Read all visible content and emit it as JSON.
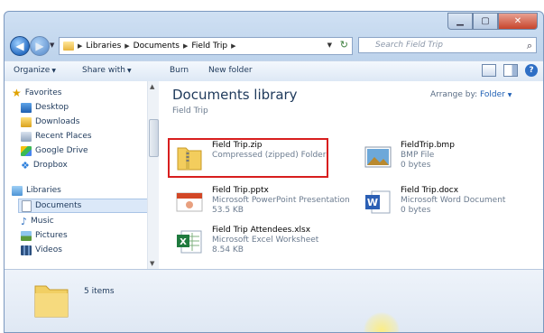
{
  "colors": {
    "accent": "#1e395b",
    "highlight_border": "#d81e1e"
  },
  "address": {
    "crumbs": [
      "Libraries",
      "Documents",
      "Field Trip"
    ],
    "search_placeholder": "Search Field Trip"
  },
  "toolbar": {
    "organize": "Organize",
    "share_with": "Share with",
    "burn": "Burn",
    "new_folder": "New folder"
  },
  "nav": {
    "favorites_header": "Favorites",
    "favorites": [
      "Desktop",
      "Downloads",
      "Recent Places",
      "Google Drive",
      "Dropbox"
    ],
    "libraries_header": "Libraries",
    "libraries": [
      "Documents",
      "Music",
      "Pictures",
      "Videos"
    ]
  },
  "main": {
    "title": "Documents library",
    "subtitle": "Field Trip",
    "arrange_label": "Arrange by:",
    "arrange_value": "Folder"
  },
  "files": [
    {
      "name": "Field Trip.zip",
      "desc": "Compressed (zipped) Folder",
      "size": "",
      "icon": "zip-folder-icon"
    },
    {
      "name": "FieldTrip.bmp",
      "desc": "BMP File",
      "size": "0 bytes",
      "icon": "bmp-image-icon"
    },
    {
      "name": "Field Trip.pptx",
      "desc": "Microsoft PowerPoint Presentation",
      "size": "53.5 KB",
      "icon": "powerpoint-icon"
    },
    {
      "name": "Field Trip.docx",
      "desc": "Microsoft Word Document",
      "size": "0 bytes",
      "icon": "word-icon"
    },
    {
      "name": "Field Trip Attendees.xlsx",
      "desc": "Microsoft Excel Worksheet",
      "size": "8.54 KB",
      "icon": "excel-icon"
    }
  ],
  "details": {
    "items_count": "5 items"
  }
}
